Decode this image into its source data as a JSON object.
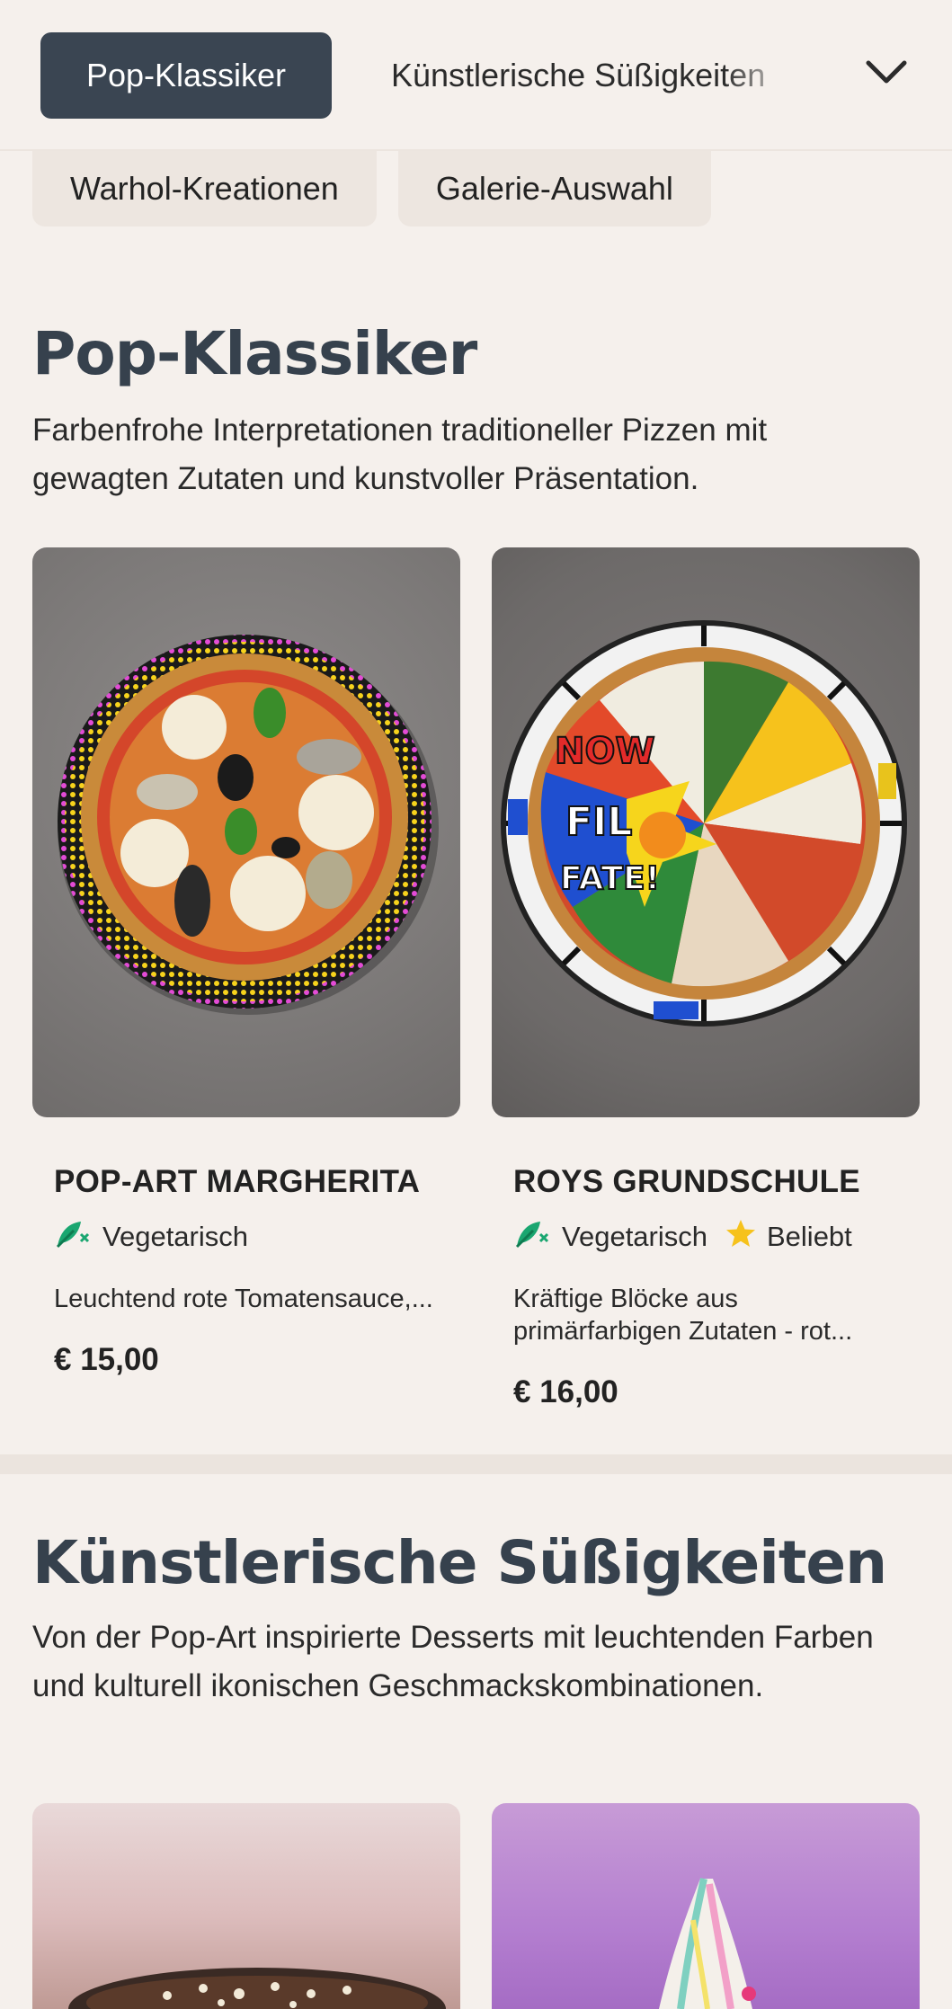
{
  "nav": {
    "active_tab": "Pop-Klassiker",
    "tab_2": "Künstlerische Süßigkeiten",
    "chips": [
      "Warhol-Kreationen",
      "Galerie-Auswahl"
    ]
  },
  "sections": [
    {
      "title": "Pop-Klassiker",
      "description": "Farbenfrohe Interpretationen traditioneller Pizzen mit gewagten Zutaten und kunstvoller Präsentation.",
      "items": [
        {
          "name": "POP-ART MARGHERITA",
          "tags": [
            {
              "label": "Vegetarisch",
              "icon": "leaf-icon"
            }
          ],
          "description": "Leuchtend rote Tomatensauce,...",
          "price": "€ 15,00"
        },
        {
          "name": "ROYS GRUNDSCHULE",
          "tags": [
            {
              "label": "Vegetarisch",
              "icon": "leaf-icon"
            },
            {
              "label": "Beliebt",
              "icon": "star-icon"
            }
          ],
          "description": "Kräftige Blöcke aus primärfarbigen Zutaten - rot...",
          "price": "€ 16,00"
        }
      ]
    },
    {
      "title": "Künstlerische Süßigkeiten",
      "description": "Von der Pop-Art inspirierte Desserts mit leuchtenden Farben und kulturell ikonischen Geschmackskombinationen."
    }
  ],
  "colors": {
    "accent_dark": "#3a4552",
    "background": "#f5f0ec",
    "veg_green": "#1aa670",
    "star_yellow": "#f6c21c"
  }
}
